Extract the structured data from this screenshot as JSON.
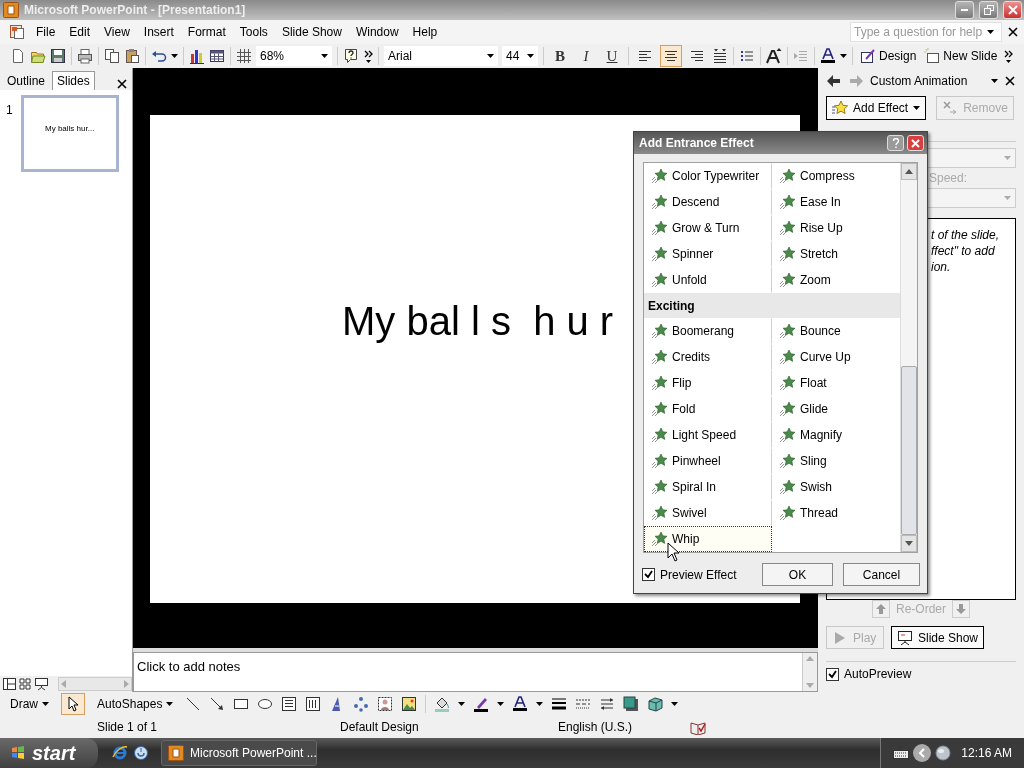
{
  "window": {
    "title": "Microsoft PowerPoint - [Presentation1]"
  },
  "menu": [
    "File",
    "Edit",
    "View",
    "Insert",
    "Format",
    "Tools",
    "Slide Show",
    "Window",
    "Help"
  ],
  "help_box": {
    "placeholder": "Type a question for help"
  },
  "toolbar": {
    "zoom": "68%",
    "font": "Arial",
    "font_size": "44",
    "bold": "B",
    "italic": "I",
    "underline": "U",
    "align_buttons": [
      {
        "selected": false
      },
      {
        "selected": true
      },
      {
        "selected": false
      }
    ],
    "design": "Design",
    "new_slide": "New Slide"
  },
  "left_pane": {
    "tabs": [
      {
        "label": "Outline",
        "selected": false
      },
      {
        "label": "Slides",
        "selected": true
      }
    ],
    "slides": [
      {
        "number": "1",
        "text": "My balls hur...",
        "selected": true
      }
    ]
  },
  "slide": {
    "title": "My bal l s  h u r"
  },
  "notes": {
    "placeholder": "Click to add notes"
  },
  "task_pane": {
    "title": "Custom Animation",
    "add_effect": "Add Effect",
    "remove": {
      "label": "Remove",
      "disabled": true
    },
    "speed_label": "Speed:",
    "hint_lines": [
      "t of the slide,",
      "ffect\" to add",
      "ion."
    ],
    "reorder_label": "Re-Order",
    "play": {
      "label": "Play",
      "disabled": true
    },
    "slide_show": "Slide Show",
    "autopreview": {
      "label": "AutoPreview",
      "checked": true
    }
  },
  "dialog": {
    "title": "Add Entrance Effect",
    "groups": [
      {
        "effects": [
          {
            "label": "Color Typewriter",
            "selected": false
          },
          {
            "label": "Compress",
            "selected": false
          },
          {
            "label": "Descend",
            "selected": false
          },
          {
            "label": "Ease In",
            "selected": false
          },
          {
            "label": "Grow & Turn",
            "selected": false
          },
          {
            "label": "Rise Up",
            "selected": false
          },
          {
            "label": "Spinner",
            "selected": false
          },
          {
            "label": "Stretch",
            "selected": false
          },
          {
            "label": "Unfold",
            "selected": false
          },
          {
            "label": "Zoom",
            "selected": false
          }
        ]
      },
      {
        "heading": "Exciting",
        "effects": [
          {
            "label": "Boomerang",
            "selected": false
          },
          {
            "label": "Bounce",
            "selected": false
          },
          {
            "label": "Credits",
            "selected": false
          },
          {
            "label": "Curve Up",
            "selected": false
          },
          {
            "label": "Flip",
            "selected": false
          },
          {
            "label": "Float",
            "selected": false
          },
          {
            "label": "Fold",
            "selected": false
          },
          {
            "label": "Glide",
            "selected": false
          },
          {
            "label": "Light Speed",
            "selected": false
          },
          {
            "label": "Magnify",
            "selected": false
          },
          {
            "label": "Pinwheel",
            "selected": false
          },
          {
            "label": "Sling",
            "selected": false
          },
          {
            "label": "Spiral In",
            "selected": false
          },
          {
            "label": "Swish",
            "selected": false
          },
          {
            "label": "Swivel",
            "selected": false
          },
          {
            "label": "Thread",
            "selected": false
          },
          {
            "label": "Whip",
            "selected": true
          }
        ]
      }
    ],
    "preview": {
      "label": "Preview Effect",
      "checked": true
    },
    "buttons": [
      "OK",
      "Cancel"
    ]
  },
  "draw_toolbar": {
    "draw": "Draw",
    "pointer": {
      "selected": true
    },
    "autoshapes": "AutoShapes"
  },
  "status_bar": [
    "Slide 1 of 1",
    "Default Design",
    "English (U.S.)"
  ],
  "taskbar": {
    "start": "start",
    "tasks": [
      "Microsoft PowerPoint ..."
    ],
    "clock": "12:16 AM"
  }
}
